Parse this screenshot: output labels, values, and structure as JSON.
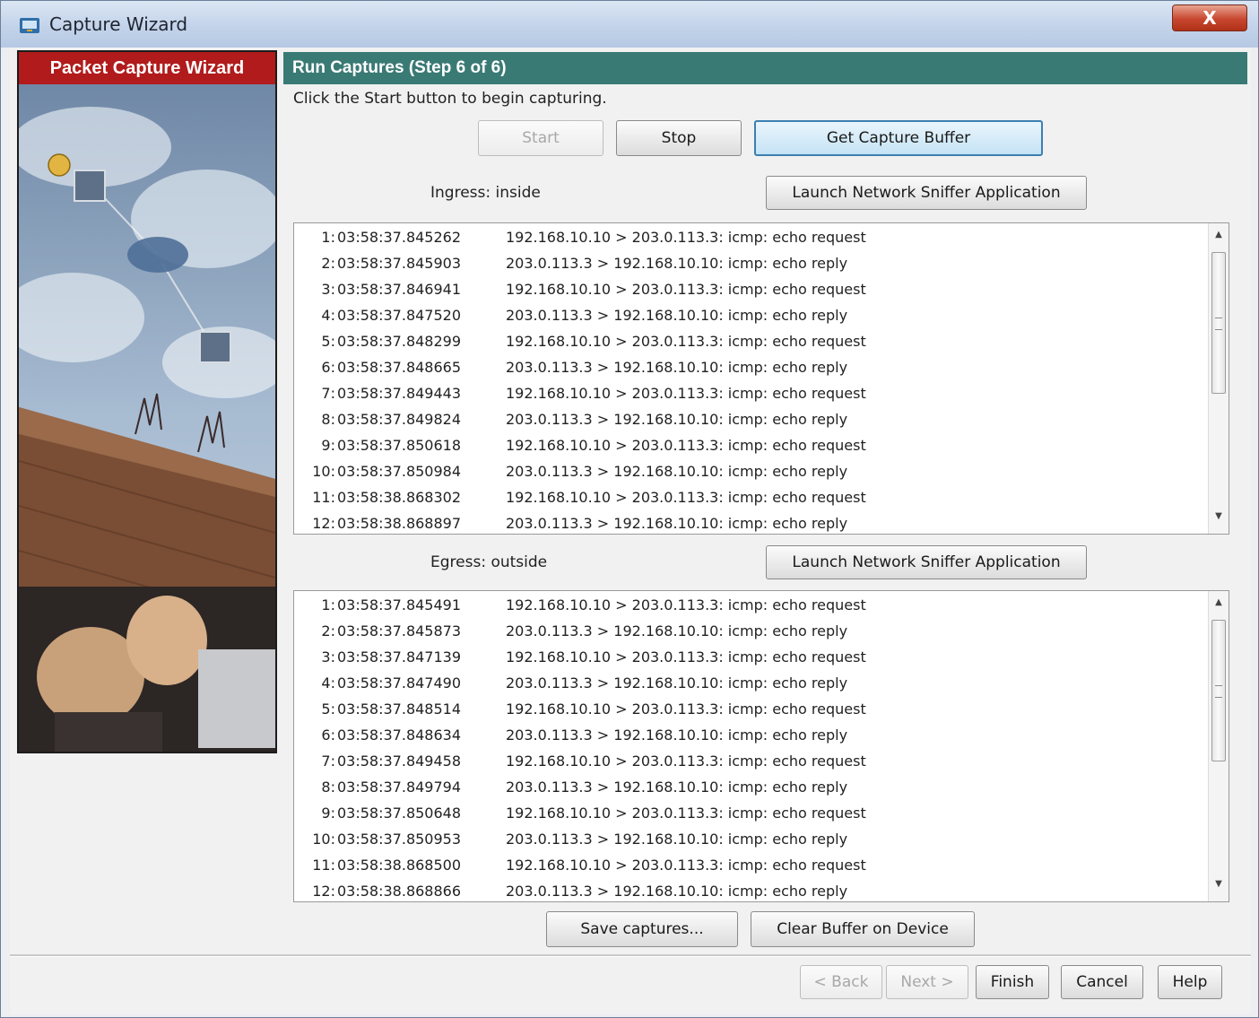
{
  "window": {
    "title": "Capture Wizard",
    "close_glyph": "X"
  },
  "sidebar": {
    "title": "Packet Capture Wizard"
  },
  "step": {
    "title": "Run Captures  (Step 6 of 6)",
    "instruction": "Click the Start button to begin capturing."
  },
  "controls": {
    "start": "Start",
    "stop": "Stop",
    "get_buffer": "Get Capture Buffer"
  },
  "ingress": {
    "label": "Ingress: inside",
    "launch": "Launch Network Sniffer Application",
    "rows": [
      {
        "num": "1:",
        "ts": "03:58:37.845262",
        "info": "192.168.10.10 > 203.0.113.3: icmp: echo request"
      },
      {
        "num": "2:",
        "ts": "03:58:37.845903",
        "info": "203.0.113.3 > 192.168.10.10: icmp: echo reply"
      },
      {
        "num": "3:",
        "ts": "03:58:37.846941",
        "info": "192.168.10.10 > 203.0.113.3: icmp: echo request"
      },
      {
        "num": "4:",
        "ts": "03:58:37.847520",
        "info": "203.0.113.3 > 192.168.10.10: icmp: echo reply"
      },
      {
        "num": "5:",
        "ts": "03:58:37.848299",
        "info": "192.168.10.10 > 203.0.113.3: icmp: echo request"
      },
      {
        "num": "6:",
        "ts": "03:58:37.848665",
        "info": "203.0.113.3 > 192.168.10.10: icmp: echo reply"
      },
      {
        "num": "7:",
        "ts": "03:58:37.849443",
        "info": "192.168.10.10 > 203.0.113.3: icmp: echo request"
      },
      {
        "num": "8:",
        "ts": "03:58:37.849824",
        "info": "203.0.113.3 > 192.168.10.10: icmp: echo reply"
      },
      {
        "num": "9:",
        "ts": "03:58:37.850618",
        "info": "192.168.10.10 > 203.0.113.3: icmp: echo request"
      },
      {
        "num": "10:",
        "ts": "03:58:37.850984",
        "info": "203.0.113.3 > 192.168.10.10: icmp: echo reply"
      },
      {
        "num": "11:",
        "ts": "03:58:38.868302",
        "info": "192.168.10.10 > 203.0.113.3: icmp: echo request"
      },
      {
        "num": "12:",
        "ts": "03:58:38.868897",
        "info": "203.0.113.3 > 192.168.10.10: icmp: echo reply"
      }
    ]
  },
  "egress": {
    "label": "Egress: outside",
    "launch": "Launch Network Sniffer Application",
    "rows": [
      {
        "num": "1:",
        "ts": "03:58:37.845491",
        "info": "192.168.10.10 > 203.0.113.3: icmp: echo request"
      },
      {
        "num": "2:",
        "ts": "03:58:37.845873",
        "info": "203.0.113.3 > 192.168.10.10: icmp: echo reply"
      },
      {
        "num": "3:",
        "ts": "03:58:37.847139",
        "info": "192.168.10.10 > 203.0.113.3: icmp: echo request"
      },
      {
        "num": "4:",
        "ts": "03:58:37.847490",
        "info": "203.0.113.3 > 192.168.10.10: icmp: echo reply"
      },
      {
        "num": "5:",
        "ts": "03:58:37.848514",
        "info": "192.168.10.10 > 203.0.113.3: icmp: echo request"
      },
      {
        "num": "6:",
        "ts": "03:58:37.848634",
        "info": "203.0.113.3 > 192.168.10.10: icmp: echo reply"
      },
      {
        "num": "7:",
        "ts": "03:58:37.849458",
        "info": "192.168.10.10 > 203.0.113.3: icmp: echo request"
      },
      {
        "num": "8:",
        "ts": "03:58:37.849794",
        "info": "203.0.113.3 > 192.168.10.10: icmp: echo reply"
      },
      {
        "num": "9:",
        "ts": "03:58:37.850648",
        "info": "192.168.10.10 > 203.0.113.3: icmp: echo request"
      },
      {
        "num": "10:",
        "ts": "03:58:37.850953",
        "info": "203.0.113.3 > 192.168.10.10: icmp: echo reply"
      },
      {
        "num": "11:",
        "ts": "03:58:38.868500",
        "info": "192.168.10.10 > 203.0.113.3: icmp: echo request"
      },
      {
        "num": "12:",
        "ts": "03:58:38.868866",
        "info": "203.0.113.3 > 192.168.10.10: icmp: echo reply"
      }
    ]
  },
  "actions": {
    "save": "Save captures...",
    "clear": "Clear Buffer on Device"
  },
  "nav": {
    "back": "< Back",
    "next": "Next >",
    "finish": "Finish",
    "cancel": "Cancel",
    "help": "Help"
  },
  "colors": {
    "accent_red": "#b11b1b",
    "accent_teal": "#3a7a74",
    "focus_blue": "#3c7fb1"
  },
  "icons": [
    "capture-wizard-app-icon",
    "close-icon",
    "scroll-up-icon",
    "scroll-down-icon",
    "scroll-thumb-grip-icon"
  ]
}
